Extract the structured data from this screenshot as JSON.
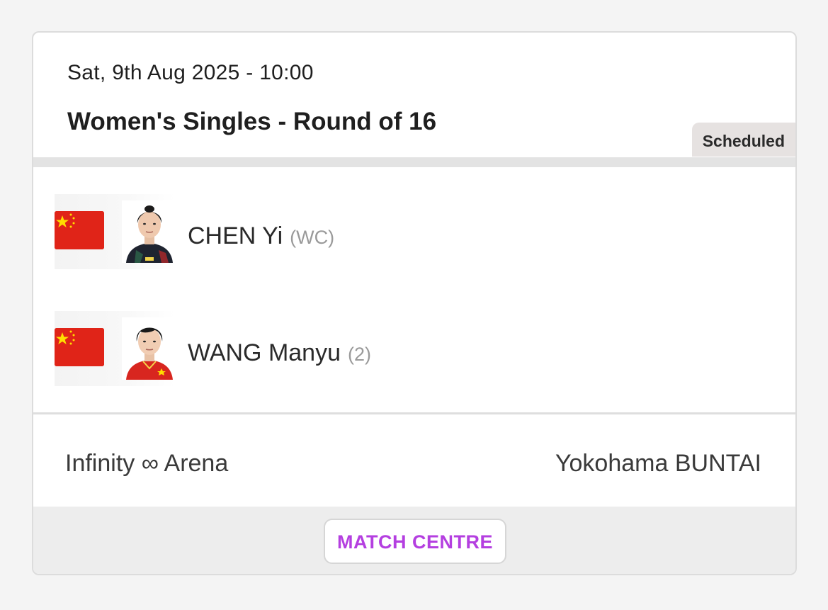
{
  "match": {
    "datetime": "Sat, 9th Aug 2025 - 10:00",
    "title": "Women's Singles - Round of 16",
    "status": "Scheduled"
  },
  "players": [
    {
      "name": "CHEN Yi",
      "seed": "(WC)",
      "flag_icon": "china-flag-icon",
      "avatar": "player-photo"
    },
    {
      "name": "WANG Manyu",
      "seed": "(2)",
      "flag_icon": "china-flag-icon",
      "avatar": "player-photo"
    }
  ],
  "venue": {
    "left": "Infinity ∞ Arena",
    "right": "Yokohama BUNTAI"
  },
  "footer": {
    "match_centre_label": "MATCH CENTRE"
  },
  "colors": {
    "accent": "#b43fe0",
    "flag_red": "#e02418",
    "flag_yellow": "#ffde00",
    "status_badge_bg": "#e6e2e1"
  }
}
